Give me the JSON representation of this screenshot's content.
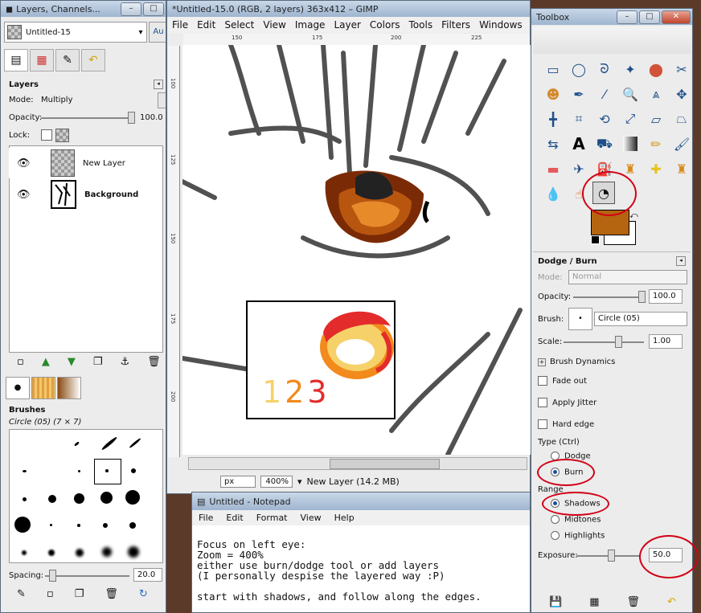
{
  "layers_window": {
    "title": "Layers, Channels...",
    "image_selector": "Untitled-15",
    "auto_button": "Au",
    "panel_title": "Layers",
    "mode_label": "Mode:",
    "mode_value": "Multiply",
    "opacity_label": "Opacity:",
    "opacity_value": "100.0",
    "lock_label": "Lock:",
    "layers": [
      {
        "name": "New Layer"
      },
      {
        "name": "Background"
      }
    ],
    "brushes_title": "Brushes",
    "brush_name": "Circle (05) (7 × 7)",
    "spacing_label": "Spacing:",
    "spacing_value": "20.0"
  },
  "image_window": {
    "title": "*Untitled-15.0 (RGB, 2 layers) 363x412 – GIMP",
    "menu": [
      "File",
      "Edit",
      "Select",
      "View",
      "Image",
      "Layer",
      "Colors",
      "Tools",
      "Filters",
      "Windows"
    ],
    "ruler_h": [
      "150",
      "175",
      "200",
      "225"
    ],
    "ruler_v": [
      "100",
      "125",
      "150",
      "175",
      "200"
    ],
    "canvas_numbers": "123",
    "unit": "px",
    "zoom": "400%",
    "status_text": "New Layer (14.2 MB)",
    "colors": {
      "red": "#e32b2b",
      "orange": "#f28a1c",
      "yellow": "#f6d16a",
      "dark_brown": "#7a2b06",
      "brown": "#b8560f"
    }
  },
  "toolbox": {
    "title": "Toolbox",
    "fg_color": "#b5640f",
    "tool_icons": [
      "rect-select",
      "ellipse-select",
      "free-select",
      "fuzzy-select",
      "select-by-color",
      "scissors",
      "foreground-select",
      "paths",
      "color-picker",
      "zoom",
      "measure",
      "move",
      "align",
      "crop",
      "rotate",
      "scale",
      "shear",
      "perspective",
      "flip",
      "text",
      "bucket-fill",
      "blend",
      "pencil",
      "paintbrush",
      "eraser",
      "airbrush",
      "ink",
      "clone",
      "heal",
      "perspective-clone",
      "blur",
      "smudge",
      "dodge-burn"
    ],
    "panel_title": "Dodge / Burn",
    "mode_label": "Mode:",
    "mode_value": "Normal",
    "opacity_label": "Opacity:",
    "opacity_value": "100.0",
    "brush_label": "Brush:",
    "brush_value": "Circle (05)",
    "scale_label": "Scale:",
    "scale_value": "1.00",
    "brush_dynamics": "Brush Dynamics",
    "fade_out": "Fade out",
    "apply_jitter": "Apply Jitter",
    "hard_edge": "Hard edge",
    "type_label": "Type  (Ctrl)",
    "type_dodge": "Dodge",
    "type_burn": "Burn",
    "range_label": "Range",
    "range_shadows": "Shadows",
    "range_midtones": "Midtones",
    "range_highlights": "Highlights",
    "exposure_label": "Exposure:",
    "exposure_value": "50.0"
  },
  "notepad": {
    "title": "Untitled - Notepad",
    "menu": [
      "File",
      "Edit",
      "Format",
      "View",
      "Help"
    ],
    "lines": [
      "Focus on left eye:",
      "Zoom = 400%",
      "either use burn/dodge tool or add layers",
      "(I personally despise the layered way :P)",
      "",
      "start with shadows, and follow along the edges."
    ]
  }
}
